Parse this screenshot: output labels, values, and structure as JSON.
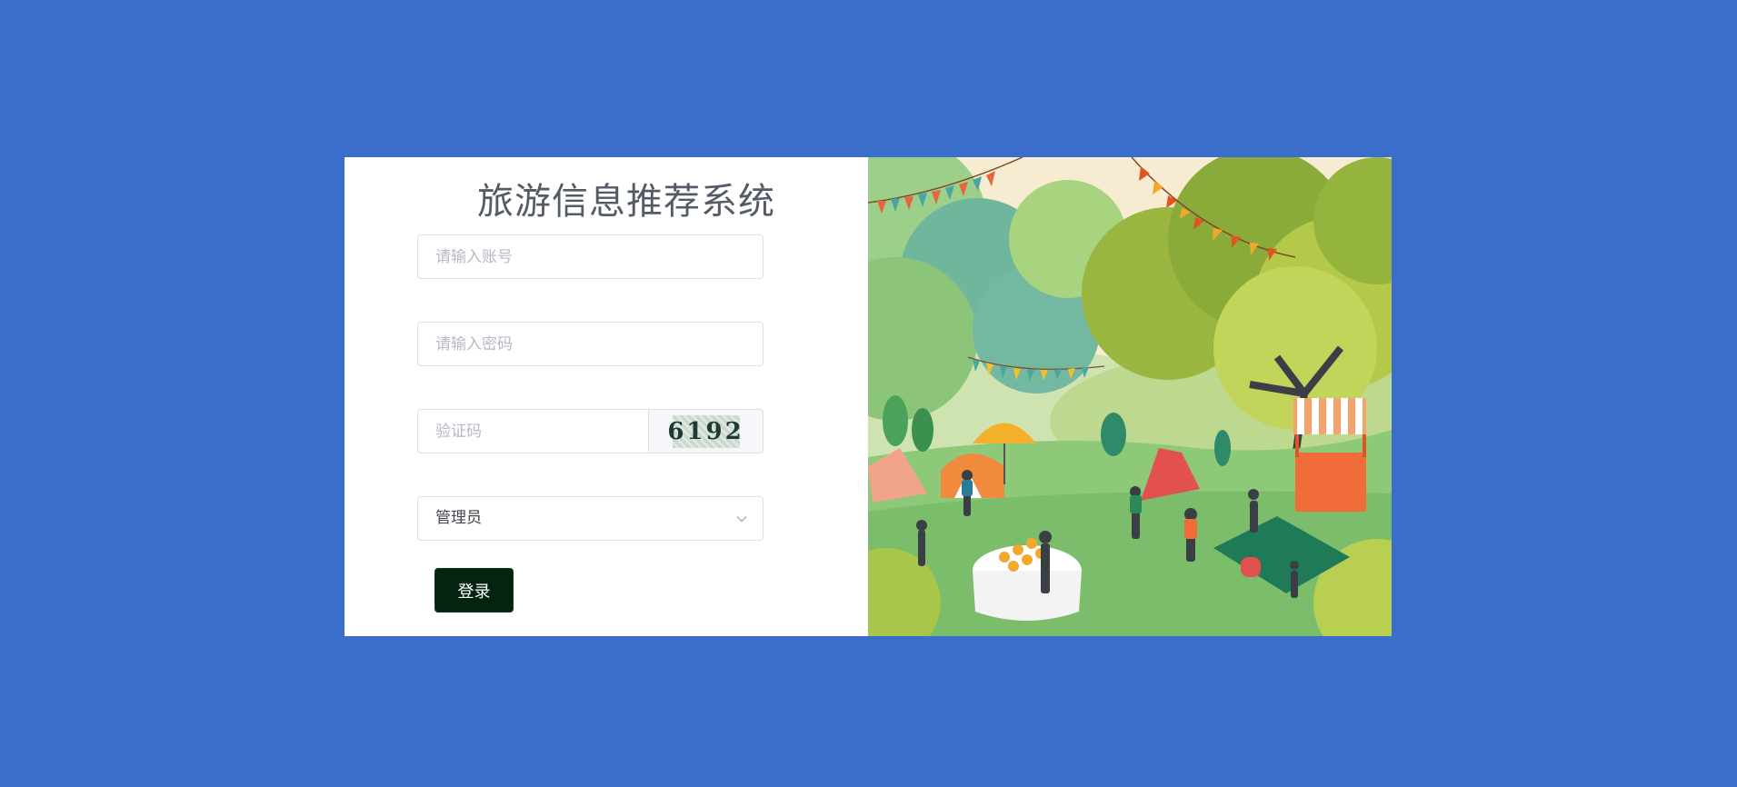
{
  "login": {
    "title": "旅游信息推荐系统",
    "account_placeholder": "请输入账号",
    "password_placeholder": "请输入密码",
    "captcha_placeholder": "验证码",
    "captcha_code": "6192",
    "role_selected": "管理员",
    "submit_label": "登录"
  },
  "illustration": {
    "description_icon": "picnic-park-illustration"
  },
  "colors": {
    "page_background": "#3b6ecb",
    "button_background": "#042412"
  }
}
